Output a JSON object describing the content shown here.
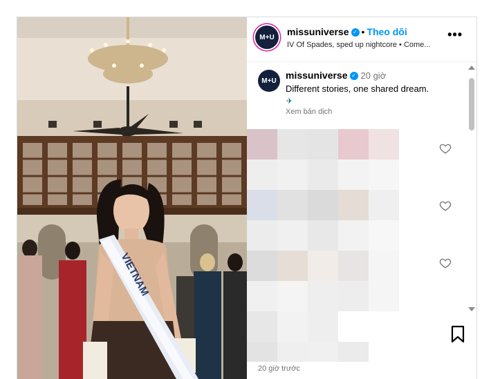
{
  "post": {
    "username": "missuniverse",
    "follow_label": "Theo dõi",
    "separator": "•",
    "audio": "IV Of Spades, sped up nightcore • Come...",
    "more_label": "•••",
    "avatar_text": "M+U"
  },
  "caption": {
    "username": "missuniverse",
    "time": "20 giờ",
    "text": "Different stories, one shared dream.",
    "emoji": "✈",
    "translate_label": "Xem bản dịch"
  },
  "media": {
    "sash_text": "VIETNAM"
  },
  "footer": {
    "posted_ago": "20 giờ trước"
  },
  "colors": {
    "accent": "#0095f6",
    "muted": "#737373",
    "border": "#dbdbdb"
  },
  "icons": {
    "verified": "verified-badge-icon",
    "more": "more-options-icon",
    "like": "heart-icon",
    "save": "bookmark-icon"
  }
}
